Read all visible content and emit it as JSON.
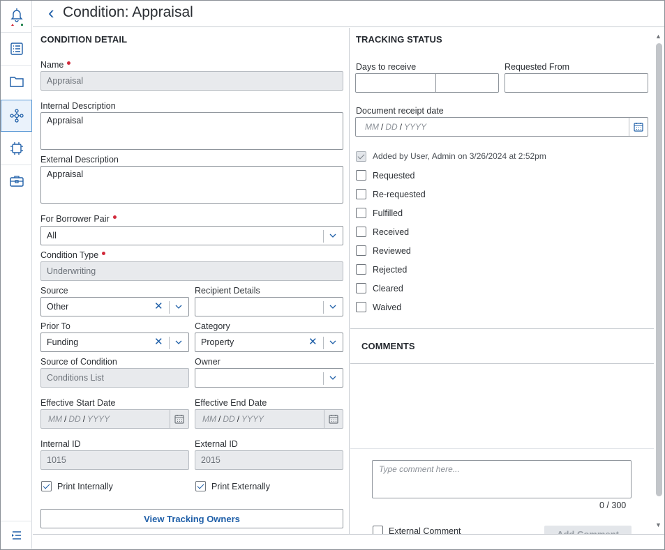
{
  "app": {
    "title": "Condition: Appraisal"
  },
  "rail": {
    "items": [
      {
        "icon": "bell-icon"
      },
      {
        "icon": "list-document-icon"
      },
      {
        "icon": "folder-icon"
      },
      {
        "icon": "network-nodes-icon",
        "active": true
      },
      {
        "icon": "chip-icon"
      },
      {
        "icon": "briefcase-icon"
      }
    ],
    "collapse_icon": "expand-menu-icon"
  },
  "condition_detail": {
    "section_title": "CONDITION DETAIL",
    "name_label": "Name",
    "name_value": "Appraisal",
    "internal_desc_label": "Internal Description",
    "internal_desc_value": "Appraisal",
    "external_desc_label": "External Description",
    "external_desc_value": "Appraisal",
    "borrower_pair_label": "For Borrower Pair",
    "borrower_pair_value": "All",
    "condition_type_label": "Condition Type",
    "condition_type_value": "Underwriting",
    "source_label": "Source",
    "source_value": "Other",
    "recipient_label": "Recipient Details",
    "recipient_value": "",
    "prior_to_label": "Prior To",
    "prior_to_value": "Funding",
    "category_label": "Category",
    "category_value": "Property",
    "source_of_condition_label": "Source of Condition",
    "source_of_condition_value": "Conditions List",
    "owner_label": "Owner",
    "owner_value": "",
    "start_date_label": "Effective Start Date",
    "end_date_label": "Effective End Date",
    "date_mm": "MM",
    "date_dd": "DD",
    "date_yyyy": "YYYY",
    "date_sep": "/",
    "internal_id_label": "Internal ID",
    "internal_id_value": "1015",
    "external_id_label": "External ID",
    "external_id_value": "2015",
    "print_internally_label": "Print Internally",
    "print_internally_checked": true,
    "print_externally_label": "Print Externally",
    "print_externally_checked": true,
    "view_tracking_owners_label": "View Tracking Owners"
  },
  "tracking_status": {
    "section_title": "TRACKING STATUS",
    "days_label": "Days to receive",
    "requested_from_label": "Requested From",
    "receipt_date_label": "Document receipt date",
    "added_by_text": "Added by User, Admin on 3/26/2024 at 2:52pm",
    "statuses": [
      {
        "label": "Requested",
        "checked": false
      },
      {
        "label": "Re-requested",
        "checked": false
      },
      {
        "label": "Fulfilled",
        "checked": false
      },
      {
        "label": "Received",
        "checked": false
      },
      {
        "label": "Reviewed",
        "checked": false
      },
      {
        "label": "Rejected",
        "checked": false
      },
      {
        "label": "Cleared",
        "checked": false
      },
      {
        "label": "Waived",
        "checked": false
      }
    ]
  },
  "comments": {
    "section_title": "COMMENTS",
    "placeholder": "Type comment here...",
    "counter": "0 / 300",
    "external_comment_label": "External Comment",
    "add_comment_label": "Add Comment"
  },
  "colors": {
    "accent": "#1f5fa8",
    "required": "#d1293a",
    "disabled_bg": "#e8eaed"
  }
}
